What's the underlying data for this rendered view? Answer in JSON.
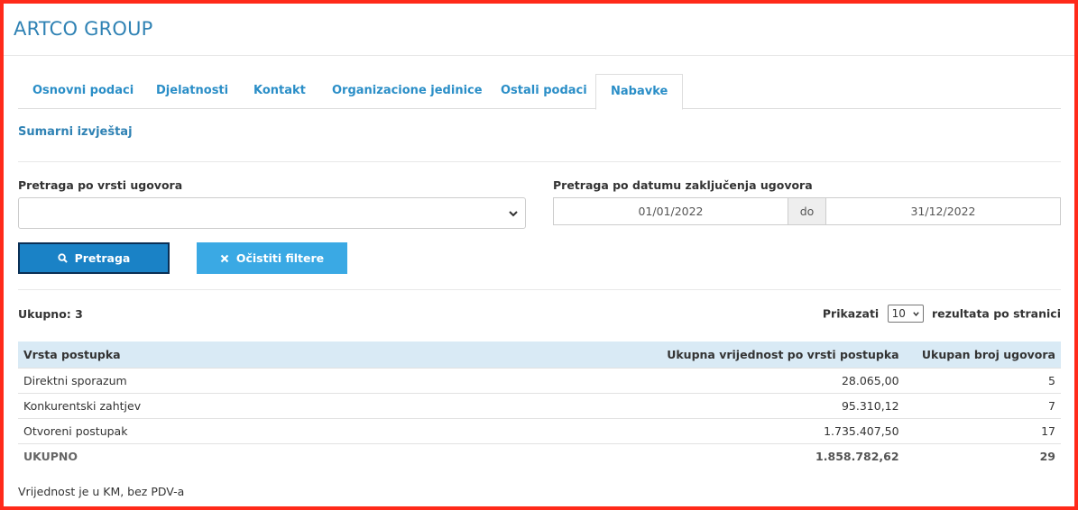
{
  "app": {
    "brand": "ARTCO GROUP"
  },
  "tabs": [
    {
      "label": "Osnovni podaci"
    },
    {
      "label": "Djelatnosti"
    },
    {
      "label": "Kontakt"
    },
    {
      "label": "Organizacione jedinice"
    },
    {
      "label": "Ostali podaci"
    },
    {
      "label": "Nabavke",
      "active": true
    }
  ],
  "section_title": "Sumarni izvještaj",
  "filters": {
    "contract_type_label": "Pretraga po vrsti ugovora",
    "contract_type_value": "",
    "date_label": "Pretraga po datumu zaključenja ugovora",
    "date_from": "01/01/2022",
    "date_sep": "do",
    "date_to": "31/12/2022"
  },
  "buttons": {
    "search": "Pretraga",
    "clear": "Očistiti filtere"
  },
  "results": {
    "total_label": "Ukupno: 3",
    "show_label": "Prikazati",
    "per_page": "10",
    "per_page_suffix": "rezultata po stranici"
  },
  "table": {
    "columns": [
      "Vrsta postupka",
      "Ukupna vrijednost po vrsti postupka",
      "Ukupan broj ugovora"
    ],
    "rows": [
      [
        "Direktni sporazum",
        "28.065,00",
        "5"
      ],
      [
        "Konkurentski zahtjev",
        "95.310,12",
        "7"
      ],
      [
        "Otvoreni postupak",
        "1.735.407,50",
        "17"
      ]
    ],
    "summary": [
      "UKUPNO",
      "1.858.782,62",
      "29"
    ]
  },
  "note": "Vrijednost je u KM, bez PDV-a",
  "colors": {
    "accent": "#2a8ec7",
    "primary_button": "#1a82c6",
    "secondary_button": "#3aa9e4",
    "table_header": "#d9eaf5",
    "frame": "#ff2a1a"
  }
}
